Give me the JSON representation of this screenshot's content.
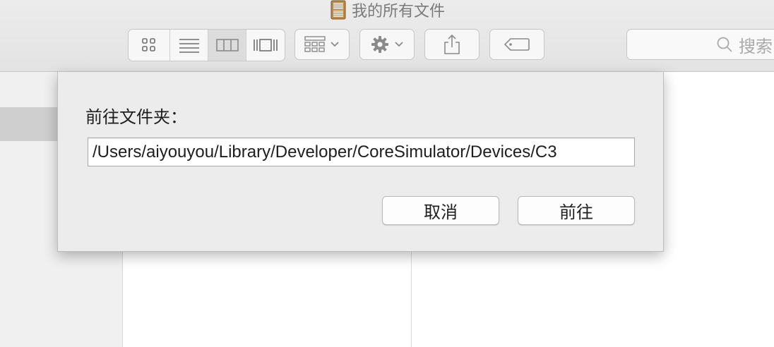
{
  "window": {
    "title": "我的所有文件",
    "title_icon": "filing-cabinet-icon"
  },
  "toolbar": {
    "view_modes": [
      {
        "name": "icon-view",
        "icon": "grid-icon",
        "active": false
      },
      {
        "name": "list-view",
        "icon": "list-icon",
        "active": false
      },
      {
        "name": "column-view",
        "icon": "columns-icon",
        "active": true
      },
      {
        "name": "cover-flow-view",
        "icon": "coverflow-icon",
        "active": false
      }
    ],
    "arrange_icon": "arrange-icon",
    "action_icon": "gear-icon",
    "share_icon": "share-icon",
    "tag_icon": "tag-icon",
    "search_placeholder": "搜索"
  },
  "dialog": {
    "label": "前往文件夹：",
    "path_value": "/Users/aiyouyou/Library/Developer/CoreSimulator/Devices/C3",
    "cancel_label": "取消",
    "go_label": "前往"
  },
  "colors": {
    "toolbar_bg": "#e6e6e6",
    "sheet_bg": "#ececec",
    "sidebar_selection": "#cfcfcf"
  }
}
